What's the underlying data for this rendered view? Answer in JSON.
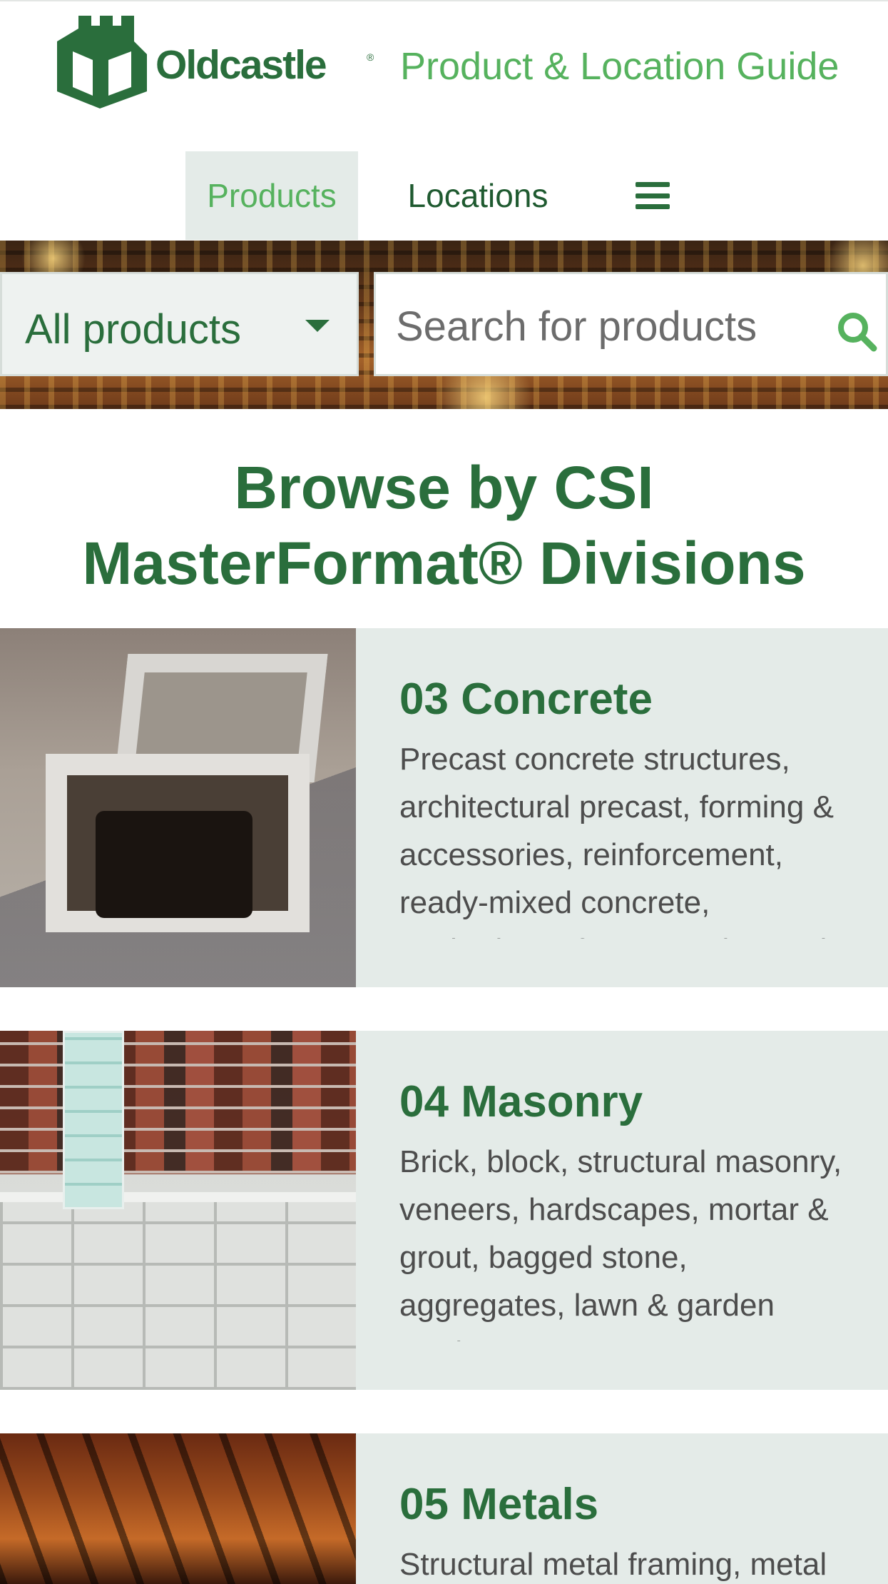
{
  "header": {
    "logo_text": "Oldcastle",
    "logo_mark": "®",
    "title": "Product & Location Guide",
    "brand_color": "#2a6e3c",
    "accent_color": "#56b25e"
  },
  "nav": {
    "products_label": "Products",
    "locations_label": "Locations",
    "menu_icon": "hamburger-menu-icon"
  },
  "search": {
    "category_selected": "All products",
    "placeholder": "Search for products",
    "search_icon": "search-icon"
  },
  "browse": {
    "heading_line1": "Browse by CSI",
    "heading_line2": "MasterFormat® Divisions"
  },
  "divisions": [
    {
      "title": "03 Concrete",
      "description": "Precast concrete structures, architectural precast, forming & accessories, reinforcement, ready-mixed concrete, anchoring & fasteners, bagged"
    },
    {
      "title": "04 Masonry",
      "description": "Brick, block, structural masonry, veneers, hardscapes, mortar & grout, bagged stone, aggregates, lawn & garden products"
    },
    {
      "title": "05 Metals",
      "description": "Structural metal framing, metal"
    }
  ]
}
